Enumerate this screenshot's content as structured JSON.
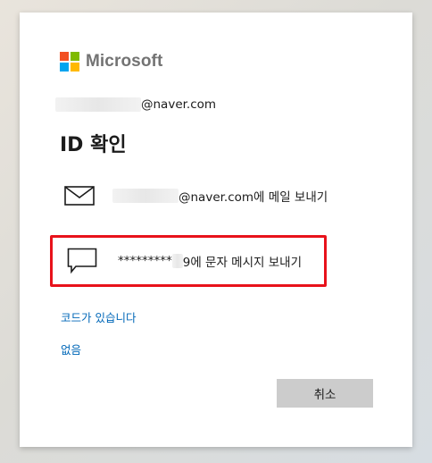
{
  "brand": {
    "name": "Microsoft",
    "colors": [
      "#f25022",
      "#7fba00",
      "#00a4ef",
      "#ffb900"
    ]
  },
  "identity": {
    "suffix": "@naver.com"
  },
  "heading": "ID 확인",
  "options": {
    "email": {
      "icon": "envelope-icon",
      "suffix": "@naver.com에 메일 보내기"
    },
    "sms": {
      "icon": "chat-bubble-icon",
      "masked_prefix": "*********",
      "suffix": "9에 문자 메시지 보내기",
      "highlight_color": "#e8121b"
    }
  },
  "links": {
    "have_code": "코드가 있습니다",
    "none": "없음"
  },
  "buttons": {
    "cancel": "취소"
  }
}
